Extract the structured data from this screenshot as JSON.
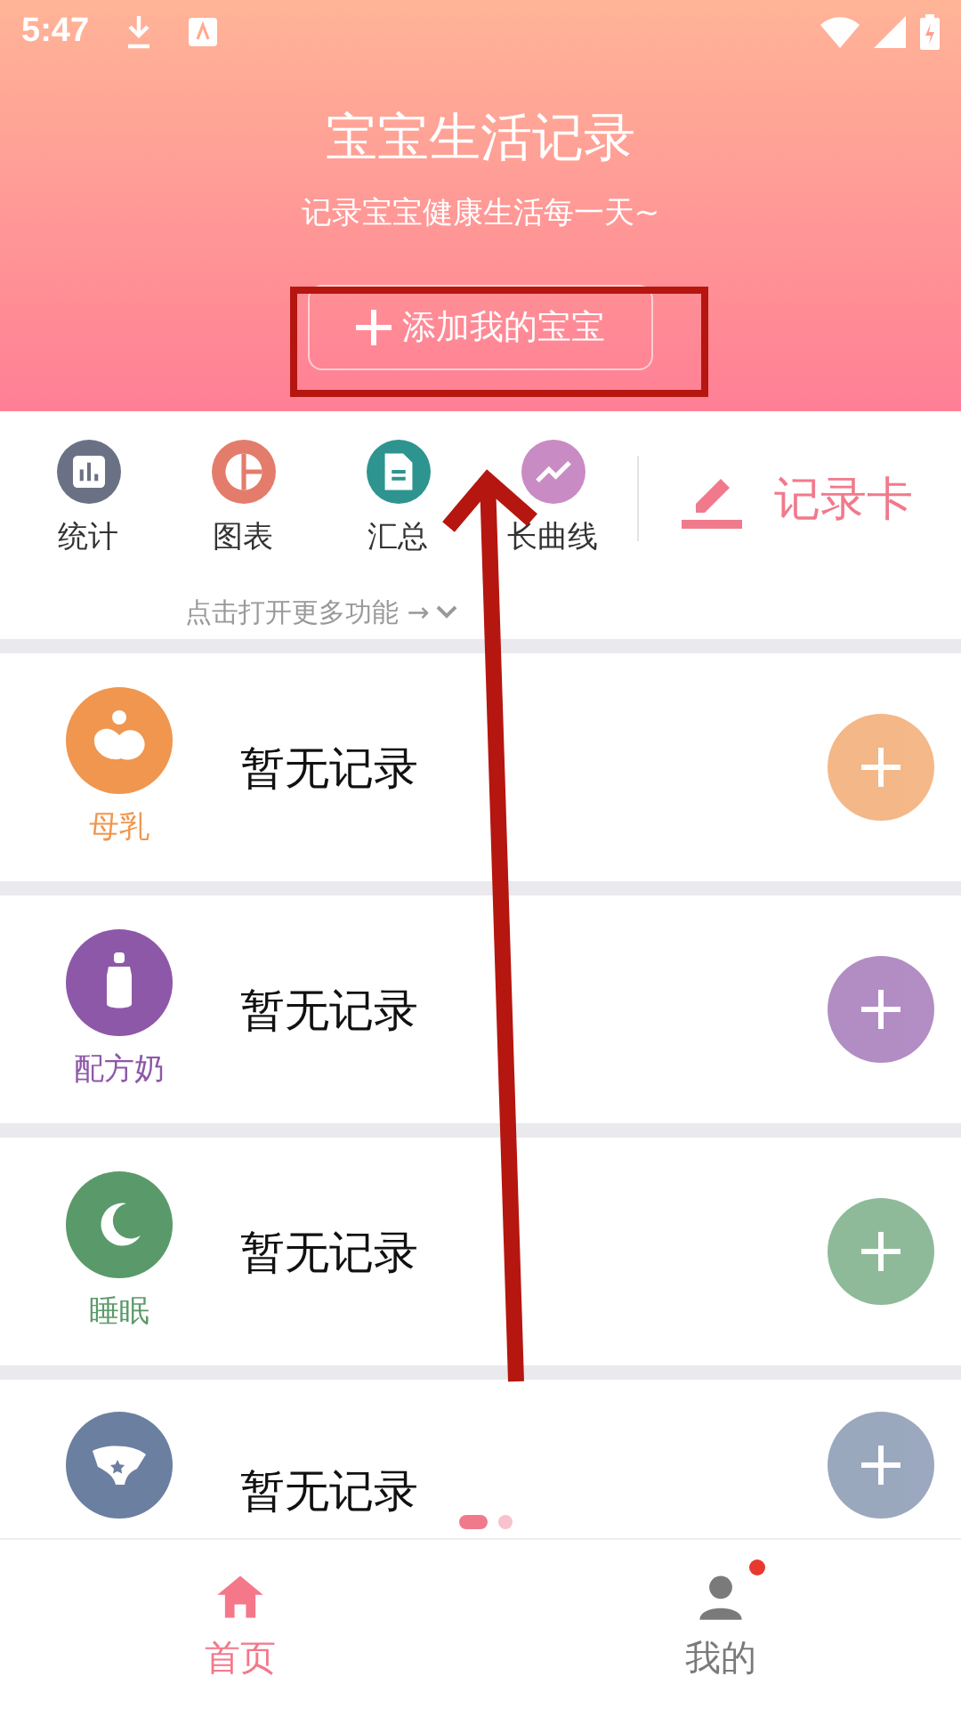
{
  "status_bar": {
    "time": "5:47"
  },
  "header": {
    "title": "宝宝生活记录",
    "subtitle": "记录宝宝健康生活每一天~",
    "add_button": "添加我的宝宝"
  },
  "quick_actions": [
    {
      "kind": "stats",
      "label": "统计",
      "color": "#6b7184"
    },
    {
      "kind": "chart",
      "label": "图表",
      "color": "#e47c6c"
    },
    {
      "kind": "summary",
      "label": "汇总",
      "color": "#2e9490"
    },
    {
      "kind": "growth",
      "label": "长曲线",
      "color": "#c98bc4"
    }
  ],
  "record_card": {
    "label": "记录卡"
  },
  "more_hint": "点击打开更多功能 →",
  "records": [
    {
      "kind": "breastfeeding",
      "label": "母乳",
      "status": "暂无记录",
      "color": "#f0964f"
    },
    {
      "kind": "formula",
      "label": "配方奶",
      "status": "暂无记录",
      "color": "#8e58a8"
    },
    {
      "kind": "sleep",
      "label": "睡眠",
      "status": "暂无记录",
      "color": "#5a9a6a"
    },
    {
      "kind": "diaper",
      "status": "暂无记录",
      "color": "#6b7fa0"
    }
  ],
  "pager": [
    {
      "selected": true
    },
    {
      "selected": false
    }
  ],
  "bottom_nav": [
    {
      "kind": "home",
      "label": "首页",
      "selected": true,
      "badge": false
    },
    {
      "kind": "profile",
      "label": "我的",
      "selected": false,
      "badge": true
    }
  ],
  "annotations": {
    "highlight_box": true,
    "arrow": true
  }
}
